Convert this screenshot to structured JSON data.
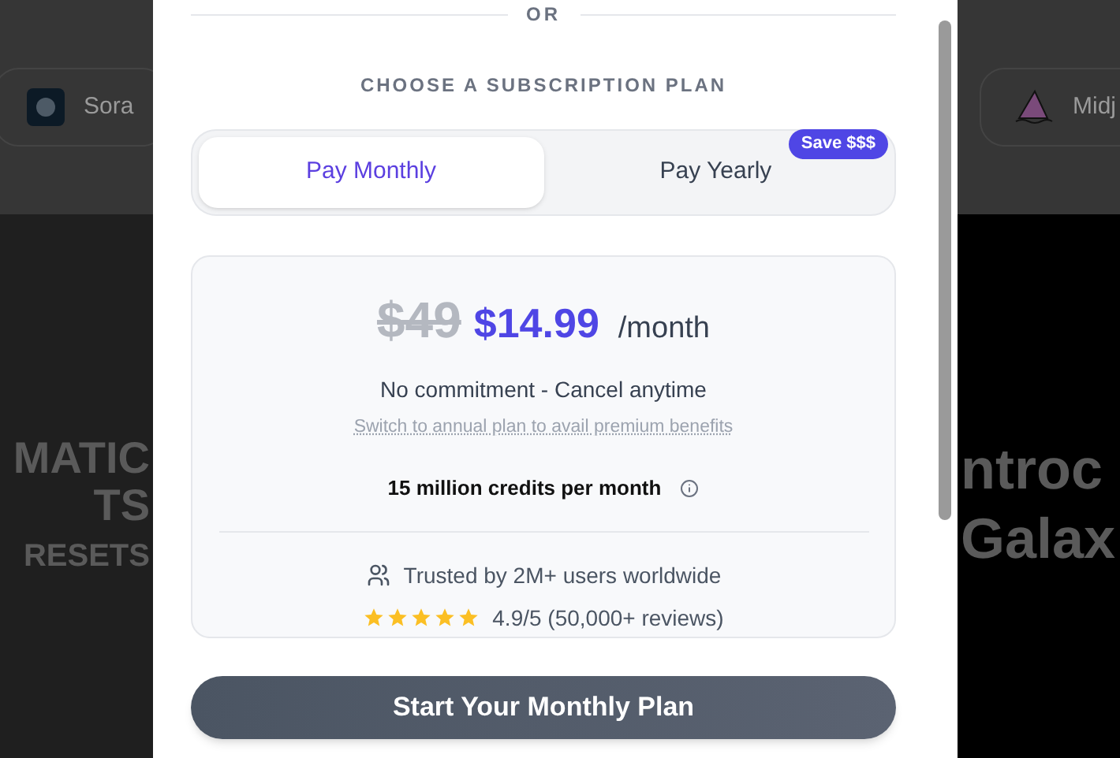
{
  "background": {
    "left_card": {
      "label": "Sora"
    },
    "right_card": {
      "label": "Midj"
    },
    "left_banner": [
      "MATIC",
      "TS",
      "RESETS"
    ],
    "right_banner": [
      "ntroc",
      "Galax"
    ]
  },
  "divider": {
    "label": "OR"
  },
  "heading": "CHOOSE A SUBSCRIPTION PLAN",
  "plan_tabs": [
    {
      "label": "Pay Monthly",
      "selected": true
    },
    {
      "label": "Pay Yearly",
      "selected": false,
      "badge": "Save $$$"
    }
  ],
  "price_card": {
    "old_price": "$49",
    "price": "$14.99",
    "period": "/month",
    "subtitle": "No commitment - Cancel anytime",
    "link": "Switch to annual plan to avail premium benefits",
    "credits": "**15 million** credits per month",
    "trust": "Trusted by 2M+ users worldwide",
    "stars": 5,
    "rating": "4.9/5 (50,000+ reviews)"
  },
  "cta_button": "Start Your Monthly Plan"
}
